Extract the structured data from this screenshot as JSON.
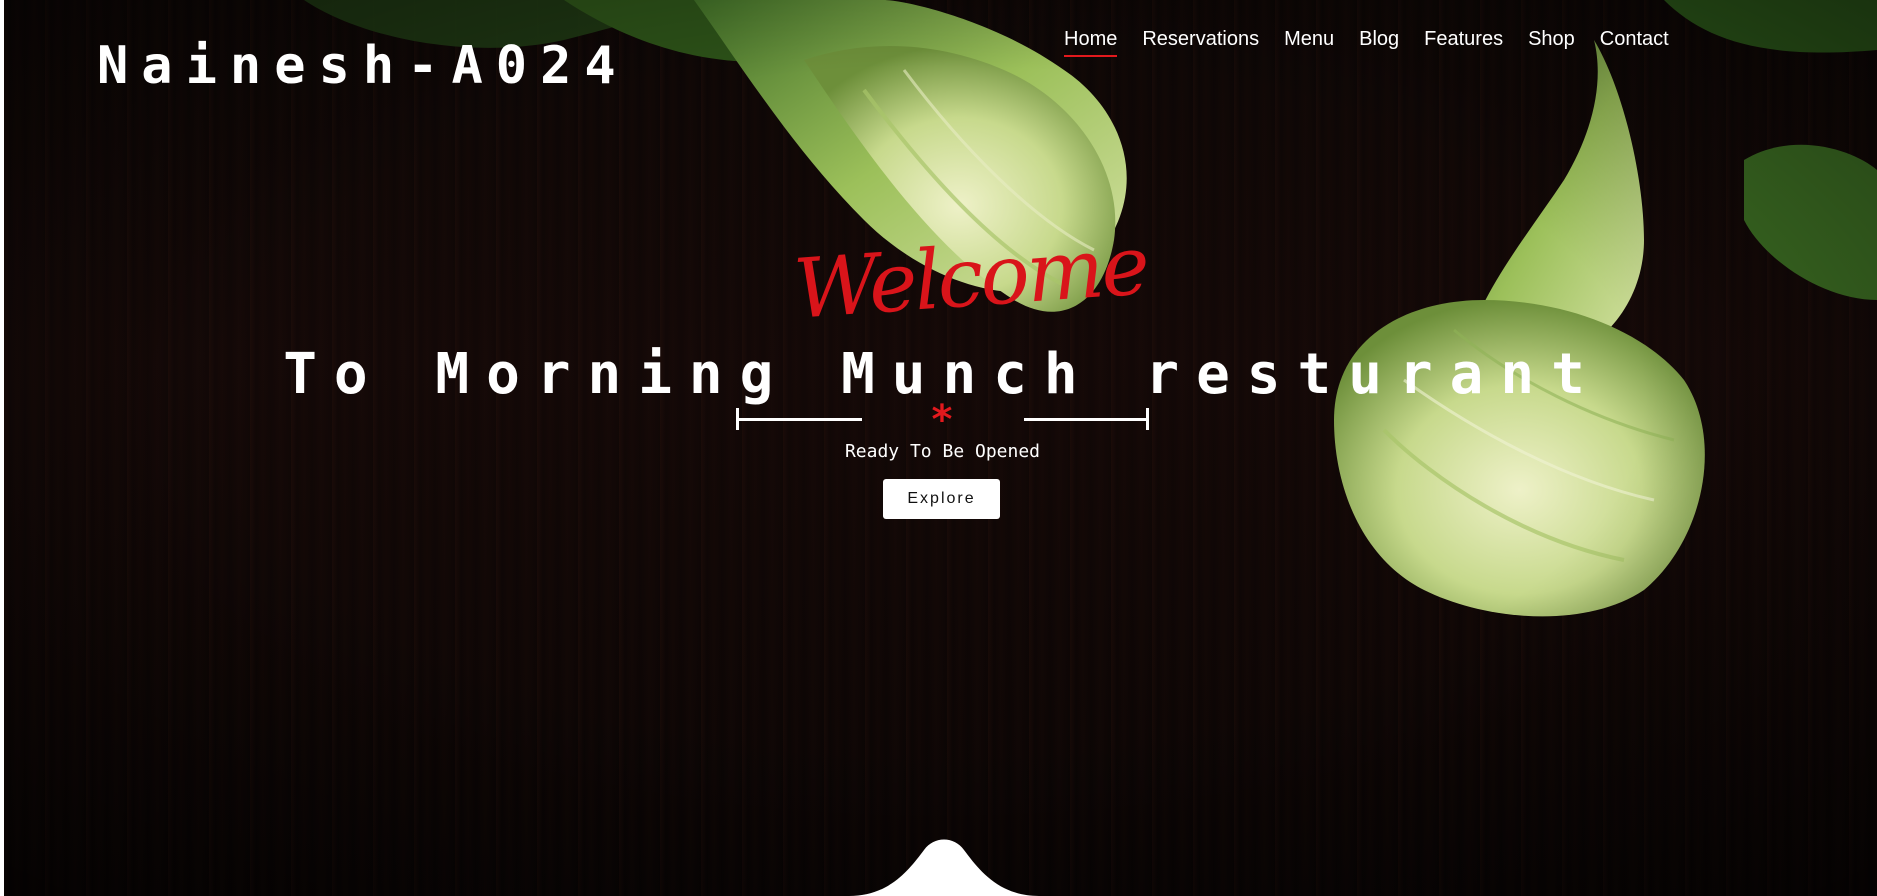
{
  "brand": {
    "name": "Nainesh-A024"
  },
  "nav": {
    "items": [
      {
        "label": "Home",
        "active": true
      },
      {
        "label": "Reservations",
        "active": false
      },
      {
        "label": "Menu",
        "active": false
      },
      {
        "label": "Blog",
        "active": false
      },
      {
        "label": "Features",
        "active": false
      },
      {
        "label": "Shop",
        "active": false
      },
      {
        "label": "Contact",
        "active": false
      }
    ]
  },
  "hero": {
    "script_heading": "Welcome",
    "headline": "To Morning Munch resturant",
    "divider_icon": "*",
    "tagline": "Ready To Be Opened",
    "button_label": "Explore",
    "background_image": "bok-choy-on-dark-wood"
  },
  "colors": {
    "accent": "#e3191d",
    "script_red": "#d9141a",
    "text": "#ffffff",
    "background": "#0d0605",
    "button_bg": "#ffffff",
    "button_text": "#111111"
  },
  "icons": {
    "scroll_notch": "wave-notch-icon"
  }
}
